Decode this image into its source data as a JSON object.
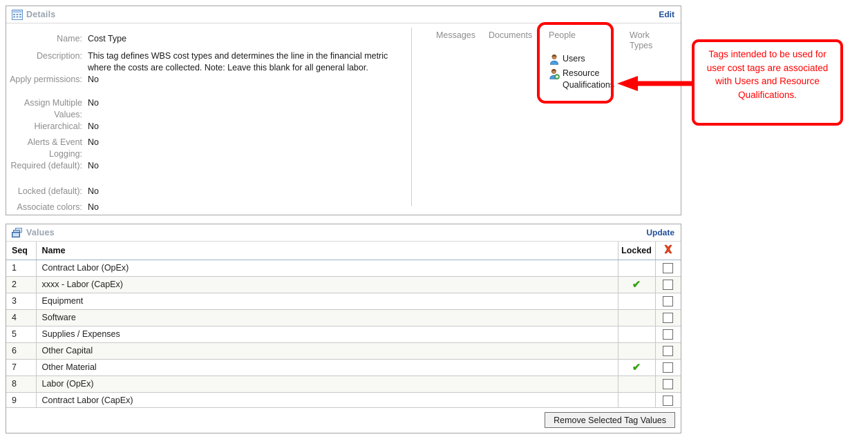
{
  "details": {
    "panel_title": "Details",
    "panel_icon": "grid-table-icon",
    "edit_label": "Edit",
    "fields": [
      {
        "label": "Name:",
        "value": "Cost Type"
      },
      {
        "label": "Description:",
        "value": "This tag defines WBS cost types and determines the line in the financial metric where the costs are collected. Note: Leave this blank for all general labor."
      },
      {
        "label": "Apply permissions:",
        "value": "No"
      },
      {
        "label": "Assign Multiple Values:",
        "value": "No"
      },
      {
        "label": "Hierarchical:",
        "value": "No"
      },
      {
        "label": "Alerts & Event Logging:",
        "value": "No"
      },
      {
        "label": "Required (default):",
        "value": "No"
      },
      {
        "label": "Locked (default):",
        "value": "No"
      },
      {
        "label": "Associate colors:",
        "value": "No"
      }
    ],
    "tabs": [
      {
        "label": "Messages"
      },
      {
        "label": "Documents"
      },
      {
        "label": "People"
      },
      {
        "label": "Work Types"
      }
    ],
    "people_links": [
      {
        "label": "Users",
        "icon": "user-icon"
      },
      {
        "label": "Resource Qualifications",
        "icon": "user-add-icon"
      }
    ]
  },
  "annotation": {
    "text": "Tags intended to be used for user cost tags are associated with Users and Resource Qualifications.",
    "color": "#ff0000",
    "highlight_target": "People"
  },
  "values": {
    "panel_title": "Values",
    "panel_icon": "stacked-pages-icon",
    "update_label": "Update",
    "columns": [
      {
        "key": "seq",
        "label": "Seq"
      },
      {
        "key": "name",
        "label": "Name"
      },
      {
        "key": "locked",
        "label": "Locked"
      },
      {
        "key": "delete",
        "label": "delete-x-icon"
      }
    ],
    "rows": [
      {
        "seq": "1",
        "name": "Contract Labor (OpEx)",
        "locked": false,
        "checked": false
      },
      {
        "seq": "2",
        "name": "xxxx - Labor (CapEx)",
        "locked": true,
        "checked": false
      },
      {
        "seq": "3",
        "name": "Equipment",
        "locked": false,
        "checked": false
      },
      {
        "seq": "4",
        "name": "Software",
        "locked": false,
        "checked": false
      },
      {
        "seq": "5",
        "name": "Supplies / Expenses",
        "locked": false,
        "checked": false
      },
      {
        "seq": "6",
        "name": "Other Capital",
        "locked": false,
        "checked": false
      },
      {
        "seq": "7",
        "name": "Other Material",
        "locked": true,
        "checked": false
      },
      {
        "seq": "8",
        "name": "Labor (OpEx)",
        "locked": false,
        "checked": false
      },
      {
        "seq": "9",
        "name": "Contract Labor (CapEx)",
        "locked": false,
        "checked": false
      }
    ],
    "remove_button_label": "Remove Selected Tag Values"
  }
}
